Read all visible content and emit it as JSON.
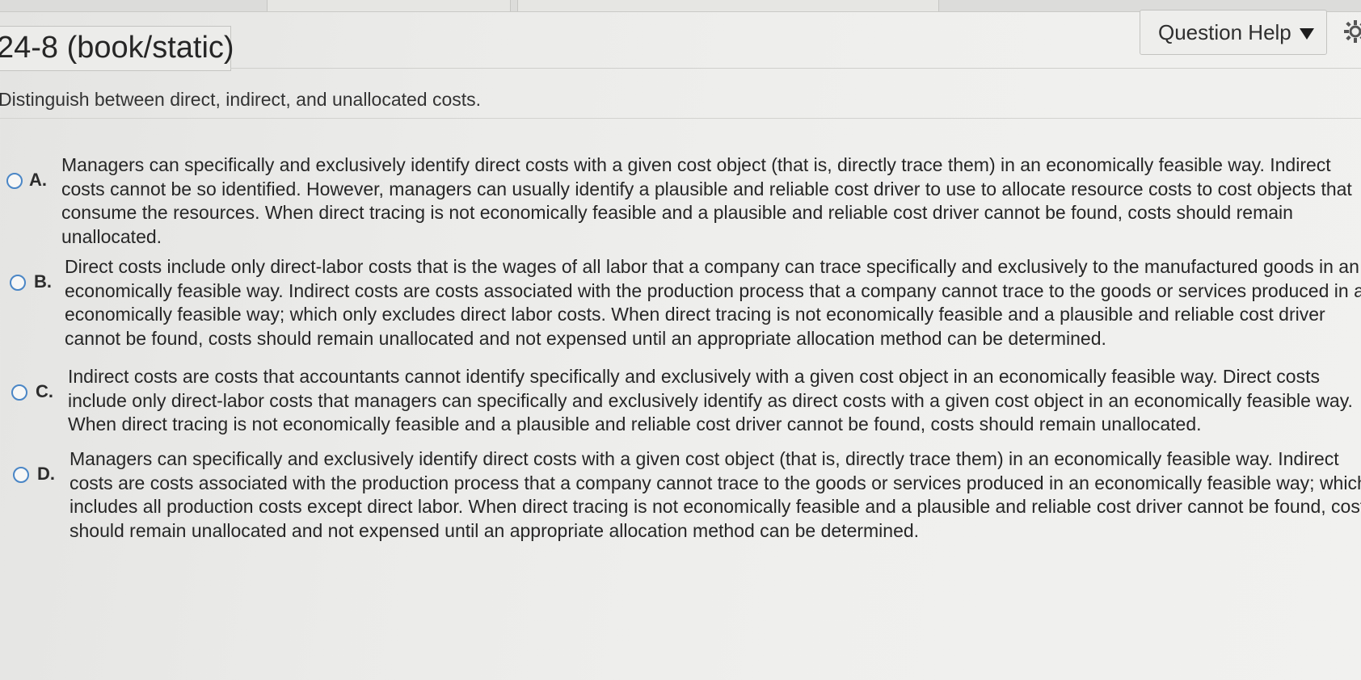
{
  "header": {
    "title": "24-8 (book/static)",
    "help_label": "Question Help",
    "help_caret_icon": "caret-down-icon",
    "settings_icon": "gear-icon"
  },
  "question": {
    "instruction": "Distinguish between direct, indirect, and unallocated costs."
  },
  "choices": [
    {
      "letter": "A.",
      "lines": [
        "Managers can specifically and exclusively identify direct costs with a given cost object (that is, directly trace them) in an economically feasible way. Indirect",
        "costs cannot be so identified. However, managers can usually identify a plausible and reliable cost driver to use to allocate resource costs to cost objects that",
        "consume the resources. When direct tracing is not economically feasible and a plausible and reliable cost driver cannot be found, costs should remain",
        "unallocated."
      ]
    },
    {
      "letter": "B.",
      "lines": [
        "Direct costs include only direct-labor costs that is the wages of all labor that a company can trace specifically and exclusively to the manufactured goods in an",
        "economically feasible way. Indirect costs are costs associated with the production process that a company cannot trace to the goods or services produced in an",
        "economically feasible way; which only excludes direct labor costs. When direct tracing is not economically feasible and a plausible and reliable cost driver",
        "cannot be found, costs should remain unallocated and not expensed until an appropriate allocation method can be determined."
      ]
    },
    {
      "letter": "C.",
      "lines": [
        "Indirect costs are costs that accountants cannot identify specifically and exclusively with a given cost object in an economically feasible way. Direct costs",
        "include only direct-labor costs that managers can specifically and exclusively identify as direct costs with a given cost object in an economically feasible way.",
        "When direct tracing is not economically feasible and a plausible and reliable cost driver cannot be found, costs should remain unallocated."
      ]
    },
    {
      "letter": "D.",
      "lines": [
        "Managers can specifically and exclusively identify direct costs with a given cost object (that is, directly trace them) in an economically feasible way. Indirect",
        "costs are costs associated with the production process that a company cannot trace to the goods or services produced in an economically feasible way; which",
        "includes all production costs except direct labor. When direct tracing is not economically feasible and a plausible and reliable cost driver cannot be found, costs",
        "should remain unallocated and not expensed until an appropriate allocation method can be determined."
      ]
    }
  ]
}
